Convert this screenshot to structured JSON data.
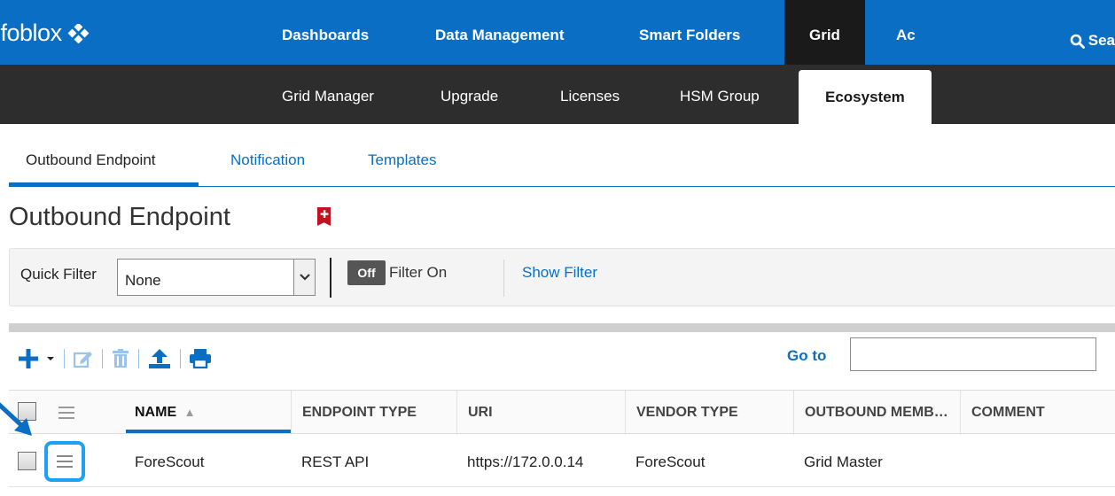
{
  "topnav": {
    "logo": "nfoblox",
    "items": [
      {
        "label": "Dashboards"
      },
      {
        "label": "Data Management"
      },
      {
        "label": "Smart Folders"
      },
      {
        "label": "Grid",
        "active": true
      },
      {
        "label": "Ac"
      }
    ],
    "search_label": "Sea"
  },
  "subnav": {
    "items": [
      {
        "label": "Grid Manager"
      },
      {
        "label": "Upgrade"
      },
      {
        "label": "Licenses"
      },
      {
        "label": "HSM Group"
      },
      {
        "label": "Ecosystem",
        "active": true
      }
    ]
  },
  "tabs": [
    {
      "label": "Outbound Endpoint",
      "active": true
    },
    {
      "label": "Notification"
    },
    {
      "label": "Templates"
    }
  ],
  "page_title": "Outbound Endpoint",
  "bookmark_symbol": "✚",
  "filter": {
    "label": "Quick Filter",
    "selected": "None",
    "toggle_state": "Off",
    "toggle_label": "Filter On",
    "show_filter": "Show Filter"
  },
  "toolbar": {
    "goto_label": "Go to",
    "goto_value": "",
    "icons": [
      "add-icon",
      "dropdown-caret-icon",
      "edit-icon",
      "delete-icon",
      "upload-icon",
      "print-icon"
    ]
  },
  "table": {
    "columns": [
      "NAME",
      "ENDPOINT TYPE",
      "URI",
      "VENDOR TYPE",
      "OUTBOUND MEMB…",
      "COMMENT"
    ],
    "sort_indicator": "▲",
    "rows": [
      {
        "name": "ForeScout",
        "endpoint_type": "REST API",
        "uri": "https://172.0.0.14",
        "vendor_type": "ForeScout",
        "outbound_member": "Grid Master",
        "comment": ""
      }
    ]
  },
  "colors": {
    "brand_blue": "#0a6ec4",
    "dark_nav": "#2d2d2d",
    "highlight": "#1da1f2",
    "bookmark_red": "#c0121f"
  }
}
